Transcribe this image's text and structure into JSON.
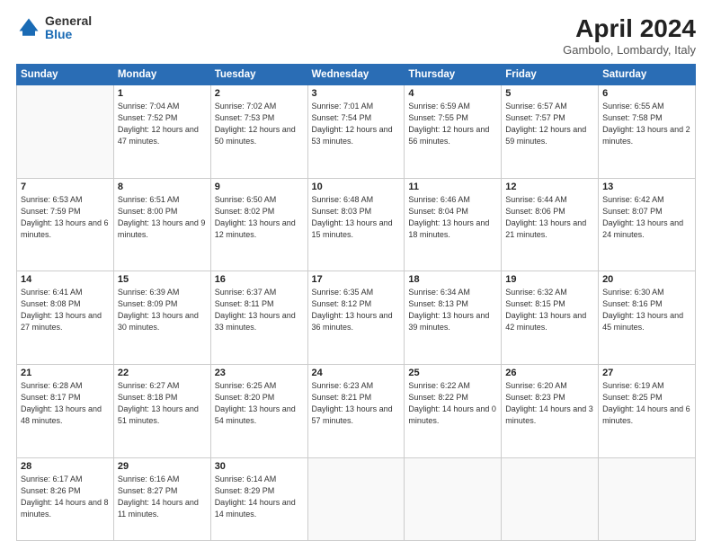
{
  "logo": {
    "general": "General",
    "blue": "Blue"
  },
  "title": "April 2024",
  "location": "Gambolo, Lombardy, Italy",
  "weekdays": [
    "Sunday",
    "Monday",
    "Tuesday",
    "Wednesday",
    "Thursday",
    "Friday",
    "Saturday"
  ],
  "weeks": [
    [
      {
        "day": null
      },
      {
        "day": 1,
        "sunrise": "7:04 AM",
        "sunset": "7:52 PM",
        "daylight": "12 hours and 47 minutes."
      },
      {
        "day": 2,
        "sunrise": "7:02 AM",
        "sunset": "7:53 PM",
        "daylight": "12 hours and 50 minutes."
      },
      {
        "day": 3,
        "sunrise": "7:01 AM",
        "sunset": "7:54 PM",
        "daylight": "12 hours and 53 minutes."
      },
      {
        "day": 4,
        "sunrise": "6:59 AM",
        "sunset": "7:55 PM",
        "daylight": "12 hours and 56 minutes."
      },
      {
        "day": 5,
        "sunrise": "6:57 AM",
        "sunset": "7:57 PM",
        "daylight": "12 hours and 59 minutes."
      },
      {
        "day": 6,
        "sunrise": "6:55 AM",
        "sunset": "7:58 PM",
        "daylight": "13 hours and 2 minutes."
      }
    ],
    [
      {
        "day": 7,
        "sunrise": "6:53 AM",
        "sunset": "7:59 PM",
        "daylight": "13 hours and 6 minutes."
      },
      {
        "day": 8,
        "sunrise": "6:51 AM",
        "sunset": "8:00 PM",
        "daylight": "13 hours and 9 minutes."
      },
      {
        "day": 9,
        "sunrise": "6:50 AM",
        "sunset": "8:02 PM",
        "daylight": "13 hours and 12 minutes."
      },
      {
        "day": 10,
        "sunrise": "6:48 AM",
        "sunset": "8:03 PM",
        "daylight": "13 hours and 15 minutes."
      },
      {
        "day": 11,
        "sunrise": "6:46 AM",
        "sunset": "8:04 PM",
        "daylight": "13 hours and 18 minutes."
      },
      {
        "day": 12,
        "sunrise": "6:44 AM",
        "sunset": "8:06 PM",
        "daylight": "13 hours and 21 minutes."
      },
      {
        "day": 13,
        "sunrise": "6:42 AM",
        "sunset": "8:07 PM",
        "daylight": "13 hours and 24 minutes."
      }
    ],
    [
      {
        "day": 14,
        "sunrise": "6:41 AM",
        "sunset": "8:08 PM",
        "daylight": "13 hours and 27 minutes."
      },
      {
        "day": 15,
        "sunrise": "6:39 AM",
        "sunset": "8:09 PM",
        "daylight": "13 hours and 30 minutes."
      },
      {
        "day": 16,
        "sunrise": "6:37 AM",
        "sunset": "8:11 PM",
        "daylight": "13 hours and 33 minutes."
      },
      {
        "day": 17,
        "sunrise": "6:35 AM",
        "sunset": "8:12 PM",
        "daylight": "13 hours and 36 minutes."
      },
      {
        "day": 18,
        "sunrise": "6:34 AM",
        "sunset": "8:13 PM",
        "daylight": "13 hours and 39 minutes."
      },
      {
        "day": 19,
        "sunrise": "6:32 AM",
        "sunset": "8:15 PM",
        "daylight": "13 hours and 42 minutes."
      },
      {
        "day": 20,
        "sunrise": "6:30 AM",
        "sunset": "8:16 PM",
        "daylight": "13 hours and 45 minutes."
      }
    ],
    [
      {
        "day": 21,
        "sunrise": "6:28 AM",
        "sunset": "8:17 PM",
        "daylight": "13 hours and 48 minutes."
      },
      {
        "day": 22,
        "sunrise": "6:27 AM",
        "sunset": "8:18 PM",
        "daylight": "13 hours and 51 minutes."
      },
      {
        "day": 23,
        "sunrise": "6:25 AM",
        "sunset": "8:20 PM",
        "daylight": "13 hours and 54 minutes."
      },
      {
        "day": 24,
        "sunrise": "6:23 AM",
        "sunset": "8:21 PM",
        "daylight": "13 hours and 57 minutes."
      },
      {
        "day": 25,
        "sunrise": "6:22 AM",
        "sunset": "8:22 PM",
        "daylight": "14 hours and 0 minutes."
      },
      {
        "day": 26,
        "sunrise": "6:20 AM",
        "sunset": "8:23 PM",
        "daylight": "14 hours and 3 minutes."
      },
      {
        "day": 27,
        "sunrise": "6:19 AM",
        "sunset": "8:25 PM",
        "daylight": "14 hours and 6 minutes."
      }
    ],
    [
      {
        "day": 28,
        "sunrise": "6:17 AM",
        "sunset": "8:26 PM",
        "daylight": "14 hours and 8 minutes."
      },
      {
        "day": 29,
        "sunrise": "6:16 AM",
        "sunset": "8:27 PM",
        "daylight": "14 hours and 11 minutes."
      },
      {
        "day": 30,
        "sunrise": "6:14 AM",
        "sunset": "8:29 PM",
        "daylight": "14 hours and 14 minutes."
      },
      {
        "day": null
      },
      {
        "day": null
      },
      {
        "day": null
      },
      {
        "day": null
      }
    ]
  ]
}
